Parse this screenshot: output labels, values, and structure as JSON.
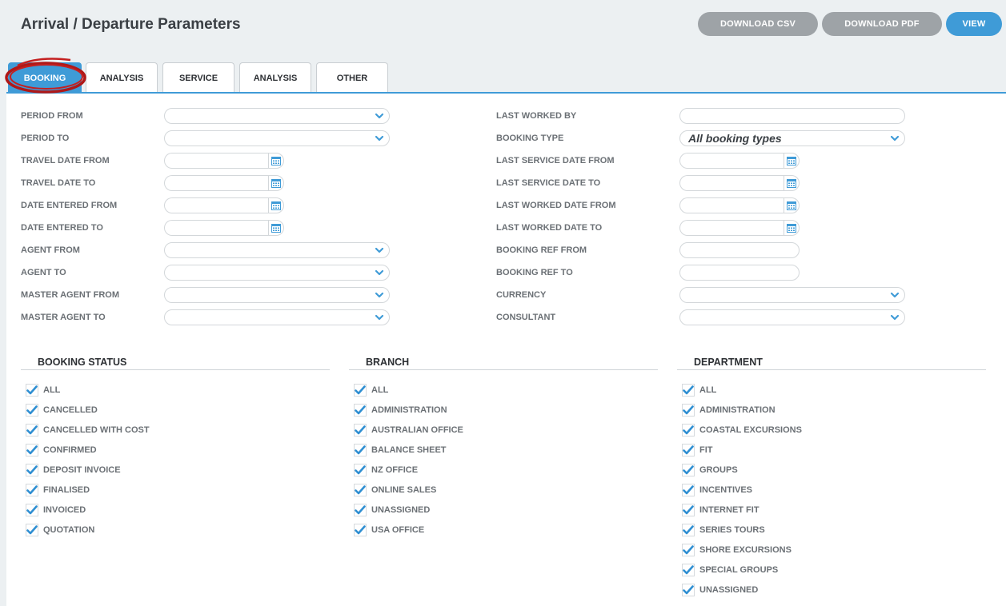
{
  "header": {
    "title": "Arrival / Departure Parameters",
    "download_csv": "DOWNLOAD CSV",
    "download_pdf": "DOWNLOAD PDF",
    "view": "VIEW"
  },
  "tabs": [
    "BOOKING",
    "ANALYSIS",
    "SERVICE",
    "ANALYSIS",
    "OTHER"
  ],
  "active_tab": "BOOKING",
  "colors": {
    "accent": "#3f9bd7",
    "grey_button": "#9ea3a7",
    "highlight_circle": "#b01818"
  },
  "left_fields": [
    {
      "label": "PERIOD FROM",
      "type": "select"
    },
    {
      "label": "PERIOD TO",
      "type": "select"
    },
    {
      "label": "TRAVEL DATE FROM",
      "type": "date"
    },
    {
      "label": "TRAVEL DATE TO",
      "type": "date"
    },
    {
      "label": "DATE ENTERED FROM",
      "type": "date"
    },
    {
      "label": "DATE ENTERED TO",
      "type": "date"
    },
    {
      "label": "AGENT FROM",
      "type": "select"
    },
    {
      "label": "AGENT TO",
      "type": "select"
    },
    {
      "label": "MASTER AGENT FROM",
      "type": "select"
    },
    {
      "label": "MASTER AGENT TO",
      "type": "select"
    }
  ],
  "right_fields": [
    {
      "label": "LAST WORKED BY",
      "type": "text-wide"
    },
    {
      "label": "BOOKING TYPE",
      "type": "select",
      "value": "All booking types"
    },
    {
      "label": "LAST SERVICE DATE FROM",
      "type": "date"
    },
    {
      "label": "LAST SERVICE DATE TO",
      "type": "date"
    },
    {
      "label": "LAST WORKED DATE FROM",
      "type": "date"
    },
    {
      "label": "LAST WORKED DATE TO",
      "type": "date"
    },
    {
      "label": "BOOKING REF FROM",
      "type": "text"
    },
    {
      "label": "BOOKING REF TO",
      "type": "text"
    },
    {
      "label": "CURRENCY",
      "type": "select"
    },
    {
      "label": "CONSULTANT",
      "type": "select"
    }
  ],
  "groups": [
    {
      "title": "BOOKING STATUS",
      "items": [
        "ALL",
        "CANCELLED",
        "CANCELLED WITH COST",
        "CONFIRMED",
        "DEPOSIT INVOICE",
        "FINALISED",
        "INVOICED",
        "QUOTATION"
      ]
    },
    {
      "title": "BRANCH",
      "items": [
        "ALL",
        "ADMINISTRATION",
        "AUSTRALIAN OFFICE",
        "BALANCE SHEET",
        "NZ OFFICE",
        "ONLINE SALES",
        "UNASSIGNED",
        "USA OFFICE"
      ]
    },
    {
      "title": "DEPARTMENT",
      "items": [
        "ALL",
        "ADMINISTRATION",
        "COASTAL EXCURSIONS",
        "FIT",
        "GROUPS",
        "INCENTIVES",
        "INTERNET FIT",
        "SERIES TOURS",
        "SHORE EXCURSIONS",
        "SPECIAL GROUPS",
        "UNASSIGNED"
      ]
    }
  ],
  "icons": {
    "select": "chevron-down-icon",
    "date": "calendar-icon",
    "checkbox": "check-icon"
  }
}
